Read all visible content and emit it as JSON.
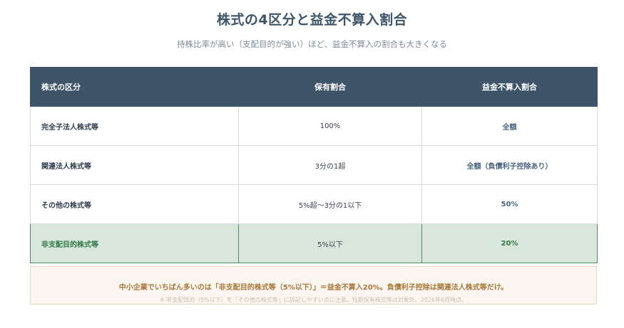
{
  "title": "株式の4区分と益金不算入割合",
  "subtitle": "持株比率が高い（支配目的が強い）ほど、益金不算入の割合も大きくなる",
  "table": {
    "headers": [
      "株式の区分",
      "保有割合",
      "益金不算入割合"
    ],
    "rows": [
      {
        "category": "完全子法人株式等",
        "holding": "100%",
        "exclusion": "全額"
      },
      {
        "category": "関連法人株式等",
        "holding": "3分の1超",
        "exclusion": "全額（負債利子控除あり）"
      },
      {
        "category": "その他の株式等",
        "holding": "5%超〜3分の1以下",
        "exclusion": "50%"
      },
      {
        "category": "非支配目的株式等",
        "holding": "5%以下",
        "exclusion": "20%"
      }
    ],
    "highlighted_row": 3
  },
  "note": {
    "main": "中小企業でいちばん多いのは「非支配目的株式等（5%以下）」＝益金不算入20%。負債利子控除は関連法人株式等だけ。",
    "sub": "※ 非支配目的（5%以下）を「その他の株式等」に誤記しやすい点に注意。短期保有株式等は対象外。2026年6月時点。"
  },
  "colors": {
    "header_bg": "#3e5469",
    "highlight_bg": "#d8e6dc",
    "highlight_text": "#2f7a47",
    "note_bg": "#faf6ef",
    "note_text": "#a9773a"
  }
}
